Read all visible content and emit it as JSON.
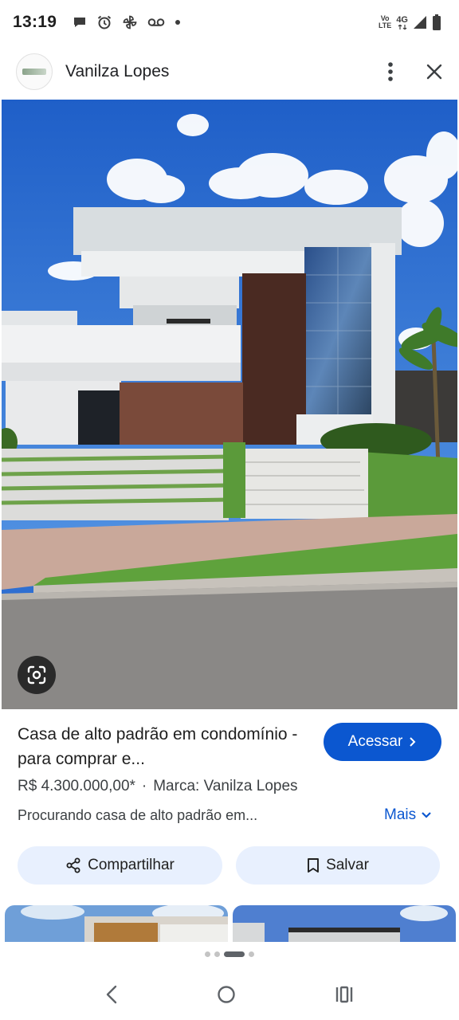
{
  "status_bar": {
    "time": "13:19",
    "notification_icons": [
      "chat-bubble-icon",
      "alarm-icon",
      "pinwheel-icon",
      "voicemail-icon",
      "dot-icon"
    ],
    "network_label_top": "Vo",
    "network_label_bottom": "LTE",
    "network_type": "4G",
    "indicators": [
      "signal-icon",
      "battery-icon"
    ]
  },
  "header": {
    "title": "Vanilza Lopes",
    "actions": [
      "more-vert-icon",
      "close-icon"
    ]
  },
  "result": {
    "title": "Casa de alto padrão em condomínio - para comprar e...",
    "visit_label": "Acessar",
    "price": "R$ 4.300.000,00*",
    "separator": "·",
    "brand": "Marca: Vanilza Lopes",
    "description": "Procurando casa de alto padrão em...",
    "more_label": "Mais",
    "share_label": "Compartilhar",
    "save_label": "Salvar"
  },
  "colors": {
    "accent": "#0b57d0",
    "pill_bg": "#e8f0fe",
    "sky": "#2f6fd1"
  }
}
